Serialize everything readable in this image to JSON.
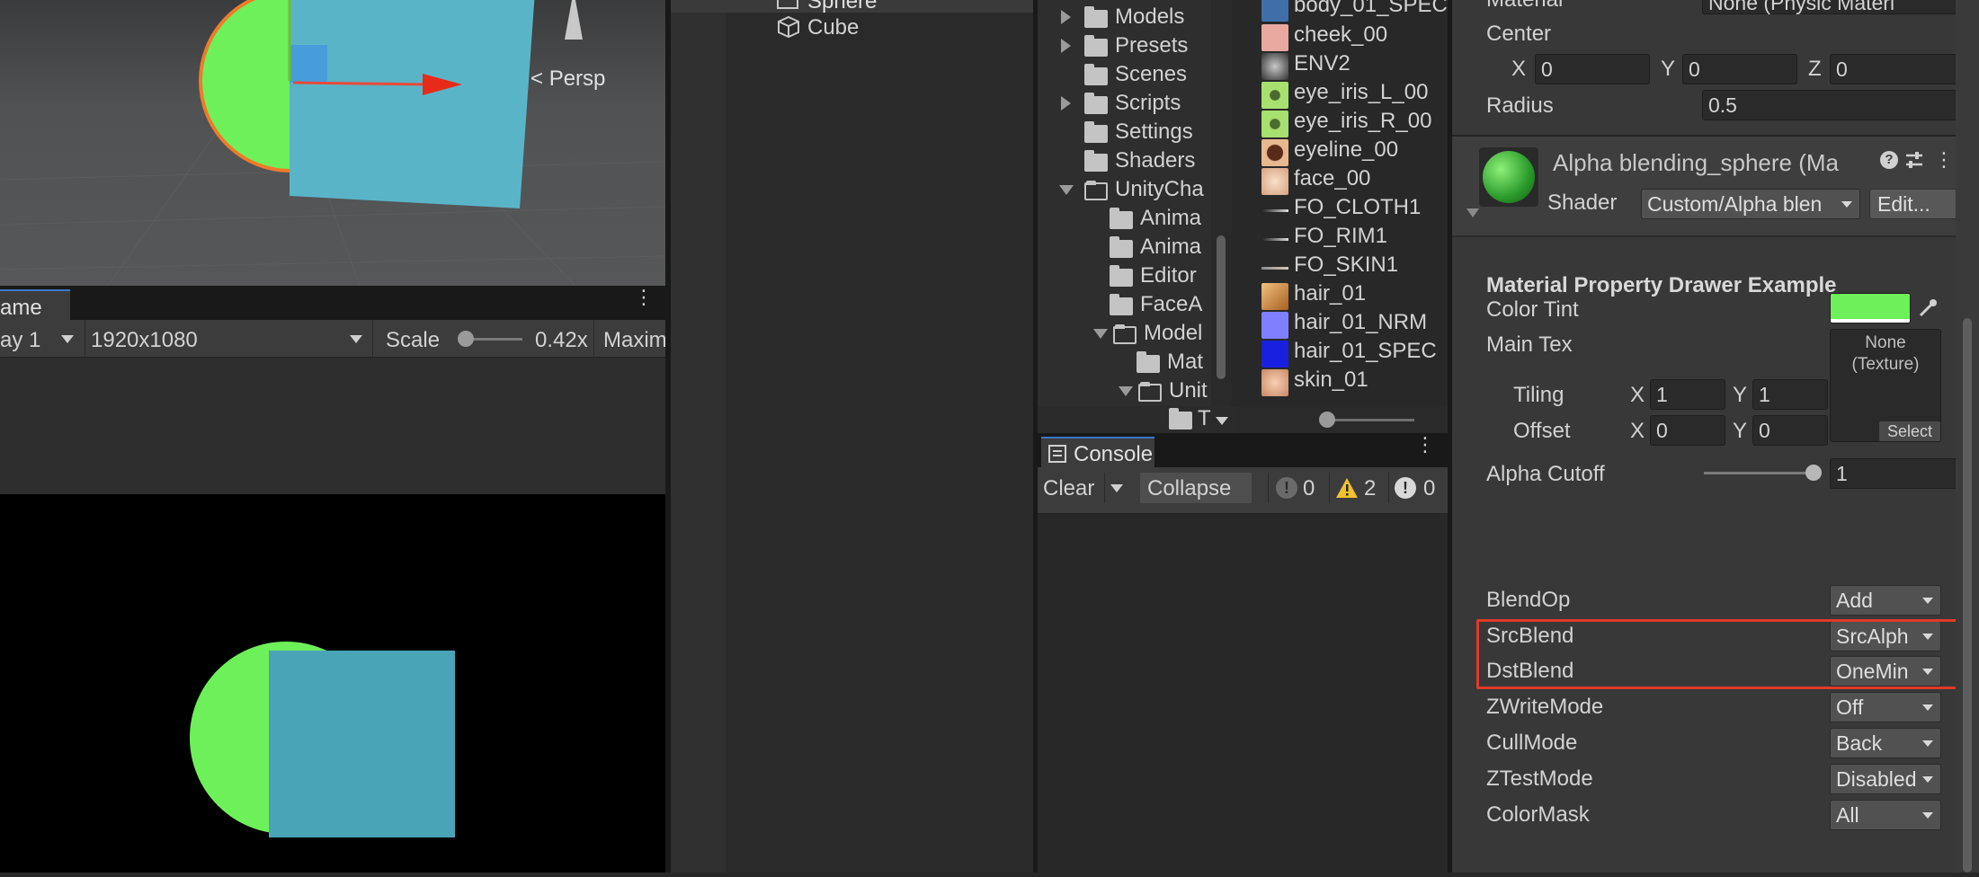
{
  "scene_view": {
    "persp_label": "Persp"
  },
  "game_view": {
    "tab_label": "ame",
    "display_label": "ay 1",
    "resolution": "1920x1080",
    "scale_label": "Scale",
    "scale_value": "0.42x",
    "maximize_label": "Maxim"
  },
  "hierarchy": {
    "items": [
      {
        "label": "Sphere"
      },
      {
        "label": "Cube"
      }
    ]
  },
  "project": {
    "folders": [
      {
        "label": "Models"
      },
      {
        "label": "Presets"
      },
      {
        "label": "Scenes"
      },
      {
        "label": "Scripts"
      },
      {
        "label": "Settings"
      },
      {
        "label": "Shaders"
      },
      {
        "label": "UnityCha"
      },
      {
        "label": "Anima"
      },
      {
        "label": "Anima"
      },
      {
        "label": "Editor"
      },
      {
        "label": "FaceA"
      },
      {
        "label": "Model"
      },
      {
        "label": "Mat"
      },
      {
        "label": "Unit"
      },
      {
        "label": "T"
      }
    ],
    "assets": [
      {
        "label": "body_01_SPEC",
        "color": "#3f6fa8"
      },
      {
        "label": "cheek_00",
        "color": "#e8a8a0"
      },
      {
        "label": "ENV2",
        "color": "#5a5a5a"
      },
      {
        "label": "eye_iris_L_00",
        "color": "#a8e070"
      },
      {
        "label": "eye_iris_R_00",
        "color": "#a8e070"
      },
      {
        "label": "eyeline_00",
        "color": "#8a4a30"
      },
      {
        "label": "face_00",
        "color": "#f0c8a8"
      },
      {
        "label": "FO_CLOTH1",
        "color": "#2a2a2a"
      },
      {
        "label": "FO_RIM1",
        "color": "#2a2a2a"
      },
      {
        "label": "FO_SKIN1",
        "color": "#2a2a2a"
      },
      {
        "label": "hair_01",
        "color": "#e0a060"
      },
      {
        "label": "hair_01_NRM",
        "color": "#8080ff"
      },
      {
        "label": "hair_01_SPEC",
        "color": "#1a20e0"
      },
      {
        "label": "skin_01",
        "color": "#e8b090"
      }
    ]
  },
  "console": {
    "tab_label": "Console",
    "clear_label": "Clear",
    "collapse_label": "Collapse",
    "errors_count": "0",
    "warnings_count": "2",
    "info_count": "0"
  },
  "inspector": {
    "collider": {
      "material_label": "Material",
      "material_value": "None (Physic Materi",
      "center_label": "Center",
      "center_x": "0",
      "center_y": "0",
      "center_z": "0",
      "radius_label": "Radius",
      "radius_value": "0.5"
    },
    "material": {
      "name": "Alpha blending_sphere (Ma",
      "shader_label": "Shader",
      "shader_value": "Custom/Alpha blen",
      "edit_label": "Edit...",
      "section_title": "Material Property Drawer Example",
      "color_tint_label": "Color Tint",
      "color_tint": "#6ef05a",
      "main_tex_label": "Main Tex",
      "texture_none": "None",
      "texture_type": "(Texture)",
      "select_label": "Select",
      "tiling_label": "Tiling",
      "tiling_x": "1",
      "tiling_y": "1",
      "offset_label": "Offset",
      "offset_x": "0",
      "offset_y": "0",
      "alpha_cutoff_label": "Alpha Cutoff",
      "alpha_cutoff_value": "1",
      "alpha_cutoff_fraction": 1.0
    },
    "properties": [
      {
        "label": "BlendOp",
        "value": "Add"
      },
      {
        "label": "SrcBlend",
        "value": "SrcAlph"
      },
      {
        "label": "DstBlend",
        "value": "OneMin"
      },
      {
        "label": "ZWriteMode",
        "value": "Off"
      },
      {
        "label": "CullMode",
        "value": "Back"
      },
      {
        "label": "ZTestMode",
        "value": "Disabled"
      },
      {
        "label": "ColorMask",
        "value": "All"
      }
    ],
    "axis_x": "X",
    "axis_y": "Y",
    "axis_z": "Z"
  },
  "colors": {
    "highlight": "#e0392a",
    "sphere": "#6ef05a",
    "cube": "#4aa8bc"
  }
}
